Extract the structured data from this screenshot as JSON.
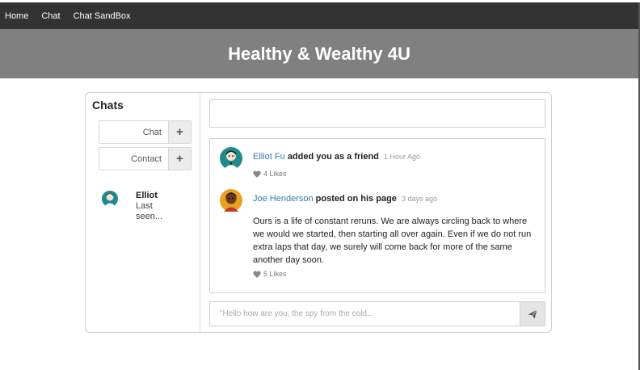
{
  "nav": {
    "items": [
      {
        "label": "Home"
      },
      {
        "label": "Chat"
      },
      {
        "label": "Chat SandBox"
      }
    ]
  },
  "banner": {
    "title": "Healthy & Wealthy 4U"
  },
  "sidebar": {
    "title": "Chats",
    "buttons": [
      {
        "label": "Chat",
        "icon": "plus-icon"
      },
      {
        "label": "Contact",
        "icon": "plus-icon"
      }
    ],
    "contacts": [
      {
        "name": "Elliot",
        "status": "Last seen..."
      }
    ]
  },
  "feed": {
    "items": [
      {
        "author": "Elliot Fu",
        "action": "added you as a friend",
        "time": "1 Hour Ago",
        "likes": "4 Likes",
        "body": ""
      },
      {
        "author": "Joe Henderson",
        "action": "posted on his page",
        "time": "3 days ago",
        "likes": "5 Likes",
        "body": "Ours is a life of constant reruns. We are always circling back to where we would we started, then starting all over again. Even if we do not run extra laps that day, we surely will come back for more of the same another day soon."
      }
    ]
  },
  "composer": {
    "placeholder": "\"Hello how are you, the spy from the cold...",
    "send_icon": "send-icon"
  },
  "colors": {
    "navbar": "#333333",
    "banner": "#808080",
    "link": "#3a78b5"
  }
}
